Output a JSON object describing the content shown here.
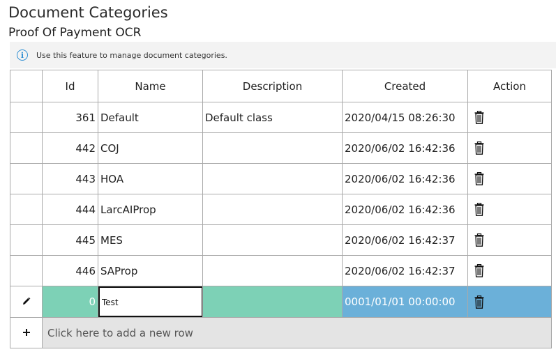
{
  "page": {
    "title": "Document Categories",
    "subtitle": "Proof Of Payment OCR"
  },
  "info": {
    "icon": "info-icon",
    "text": "Use this feature to manage document categories."
  },
  "table": {
    "columns": [
      "Id",
      "Name",
      "Description",
      "Created",
      "Action"
    ],
    "rows": [
      {
        "id": "361",
        "name": "Default",
        "description": "Default class",
        "created": "2020/04/15 08:26:30"
      },
      {
        "id": "442",
        "name": "COJ",
        "description": "",
        "created": "2020/06/02 16:42:36"
      },
      {
        "id": "443",
        "name": "HOA",
        "description": "",
        "created": "2020/06/02 16:42:36"
      },
      {
        "id": "444",
        "name": "LarcAIProp",
        "description": "",
        "created": "2020/06/02 16:42:36"
      },
      {
        "id": "445",
        "name": "MES",
        "description": "",
        "created": "2020/06/02 16:42:37"
      },
      {
        "id": "446",
        "name": "SAProp",
        "description": "",
        "created": "2020/06/02 16:42:37"
      }
    ],
    "edit_row": {
      "id": "0",
      "name": "Test",
      "description": "",
      "created": "0001/01/01 00:00:00",
      "indicator_icon": "pencil-icon"
    },
    "add_row": {
      "icon": "plus-icon",
      "text": "Click here to add a new row"
    },
    "action_icon": "trash-icon"
  },
  "colors": {
    "edit_green": "#7dd1b6",
    "edit_blue": "#6bb0d9",
    "info_blue": "#2f8fd3"
  }
}
